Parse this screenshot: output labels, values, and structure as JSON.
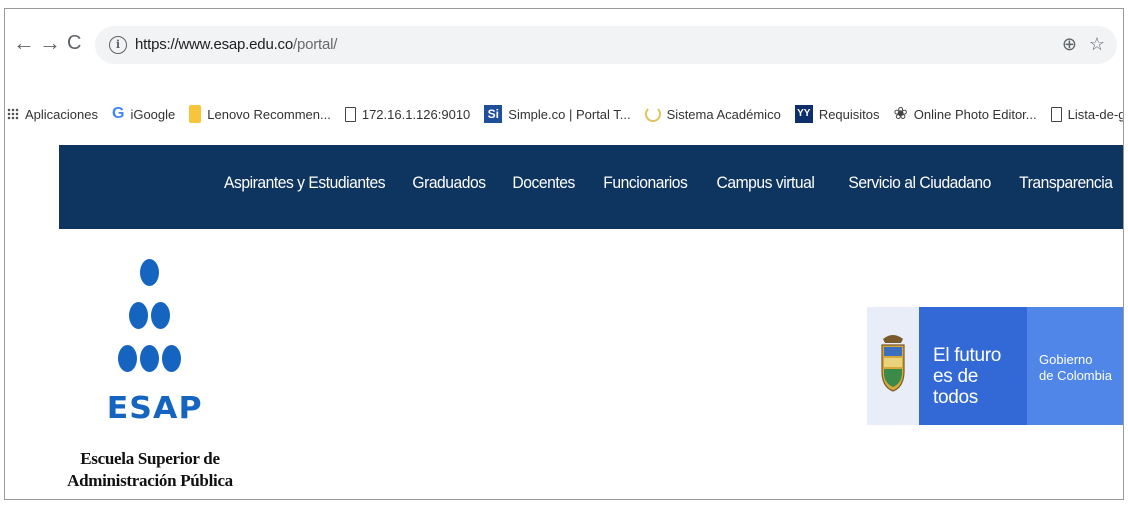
{
  "browser": {
    "back_icon": "←",
    "forward_icon": "→",
    "reload_icon": "C",
    "url_main": "https://www.esap.edu.co",
    "url_path": "/portal/",
    "zoom_icon": "⊕",
    "star_icon": "☆"
  },
  "bookmarks": [
    {
      "label": "Aplicaciones",
      "icon": "apps-icon"
    },
    {
      "label": "iGoogle",
      "icon": "google-icon"
    },
    {
      "label": "Lenovo Recommen...",
      "icon": "folder-icon"
    },
    {
      "label": "172.16.1.126:9010",
      "icon": "page-icon"
    },
    {
      "label": "Simple.co | Portal T...",
      "icon": "si-icon"
    },
    {
      "label": "Sistema Académico",
      "icon": "spinner-icon"
    },
    {
      "label": "Requisitos",
      "icon": "requisitos-icon"
    },
    {
      "label": "Online Photo Editor...",
      "icon": "photo-editor-icon"
    },
    {
      "label": "Lista-de-graduando...",
      "icon": "page-icon"
    }
  ],
  "site_nav": {
    "links": [
      "Aspirantes y Estudiantes",
      "Graduados",
      "Docentes",
      "Funcionarios",
      "Campus virtual",
      "Servicio al Ciudadano",
      "Transparencia"
    ]
  },
  "logo": {
    "word": "ESAP",
    "caption_line1": "Escuela Superior de",
    "caption_line2": "Administración Pública"
  },
  "gov_banner": {
    "slogan_line1": "El futuro",
    "slogan_line2": "es de todos",
    "gov_line1": "Gobierno",
    "gov_line2": "de Colombia"
  },
  "colors": {
    "nav_bg": "#0e3460",
    "logo_blue": "#1565c0",
    "banner_blue": "#3369d6",
    "banner_light_blue": "#4f86e8"
  }
}
